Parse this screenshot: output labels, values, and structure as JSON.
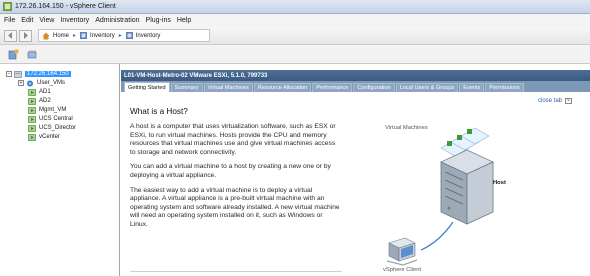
{
  "window": {
    "title": "172.26.164.150 - vSphere Client"
  },
  "menu": [
    "File",
    "Edit",
    "View",
    "Inventory",
    "Administration",
    "Plug-ins",
    "Help"
  ],
  "breadcrumb": {
    "home": "Home",
    "items": [
      "Inventory",
      "Inventory"
    ]
  },
  "tree": {
    "root": "172.26.164.150",
    "items": [
      "User_VMs",
      "AD1",
      "AD2",
      "Mgmt_VM",
      "UCS Central",
      "UCS_Director",
      "vCenter"
    ]
  },
  "host_header": "L01-VM-Host-Metro-02 VMware ESXi, 5.1.0, 799733",
  "tabs": [
    "Getting Started",
    "Summary",
    "Virtual Machines",
    "Resource Allocation",
    "Performance",
    "Configuration",
    "Local Users & Groups",
    "Events",
    "Permissions"
  ],
  "close_tab": "close tab",
  "article": {
    "heading": "What is a Host?",
    "paragraphs": [
      "A host is a computer that uses virtualization software, such as ESX or ESXi, to run virtual machines. Hosts provide the CPU and memory resources that virtual machines use and give virtual machines access to storage and network connectivity.",
      "You can add a virtual machine to a host by creating a new one or by deploying a virtual appliance.",
      "The easiest way to add a virtual machine is to deploy a virtual appliance. A virtual appliance is a pre-built virtual machine with an operating system and software already installed. A new virtual machine will need an operating system installed on it, such as Windows or Linux."
    ]
  },
  "diagram": {
    "vm_label": "Virtual Machines",
    "host_label": "Host",
    "client_label": "vSphere Client"
  },
  "colors": {
    "header": "#3b5a80",
    "tab_strip": "#7d97b6",
    "link": "#2a5ea8",
    "vm_green": "#3c9a3c"
  }
}
